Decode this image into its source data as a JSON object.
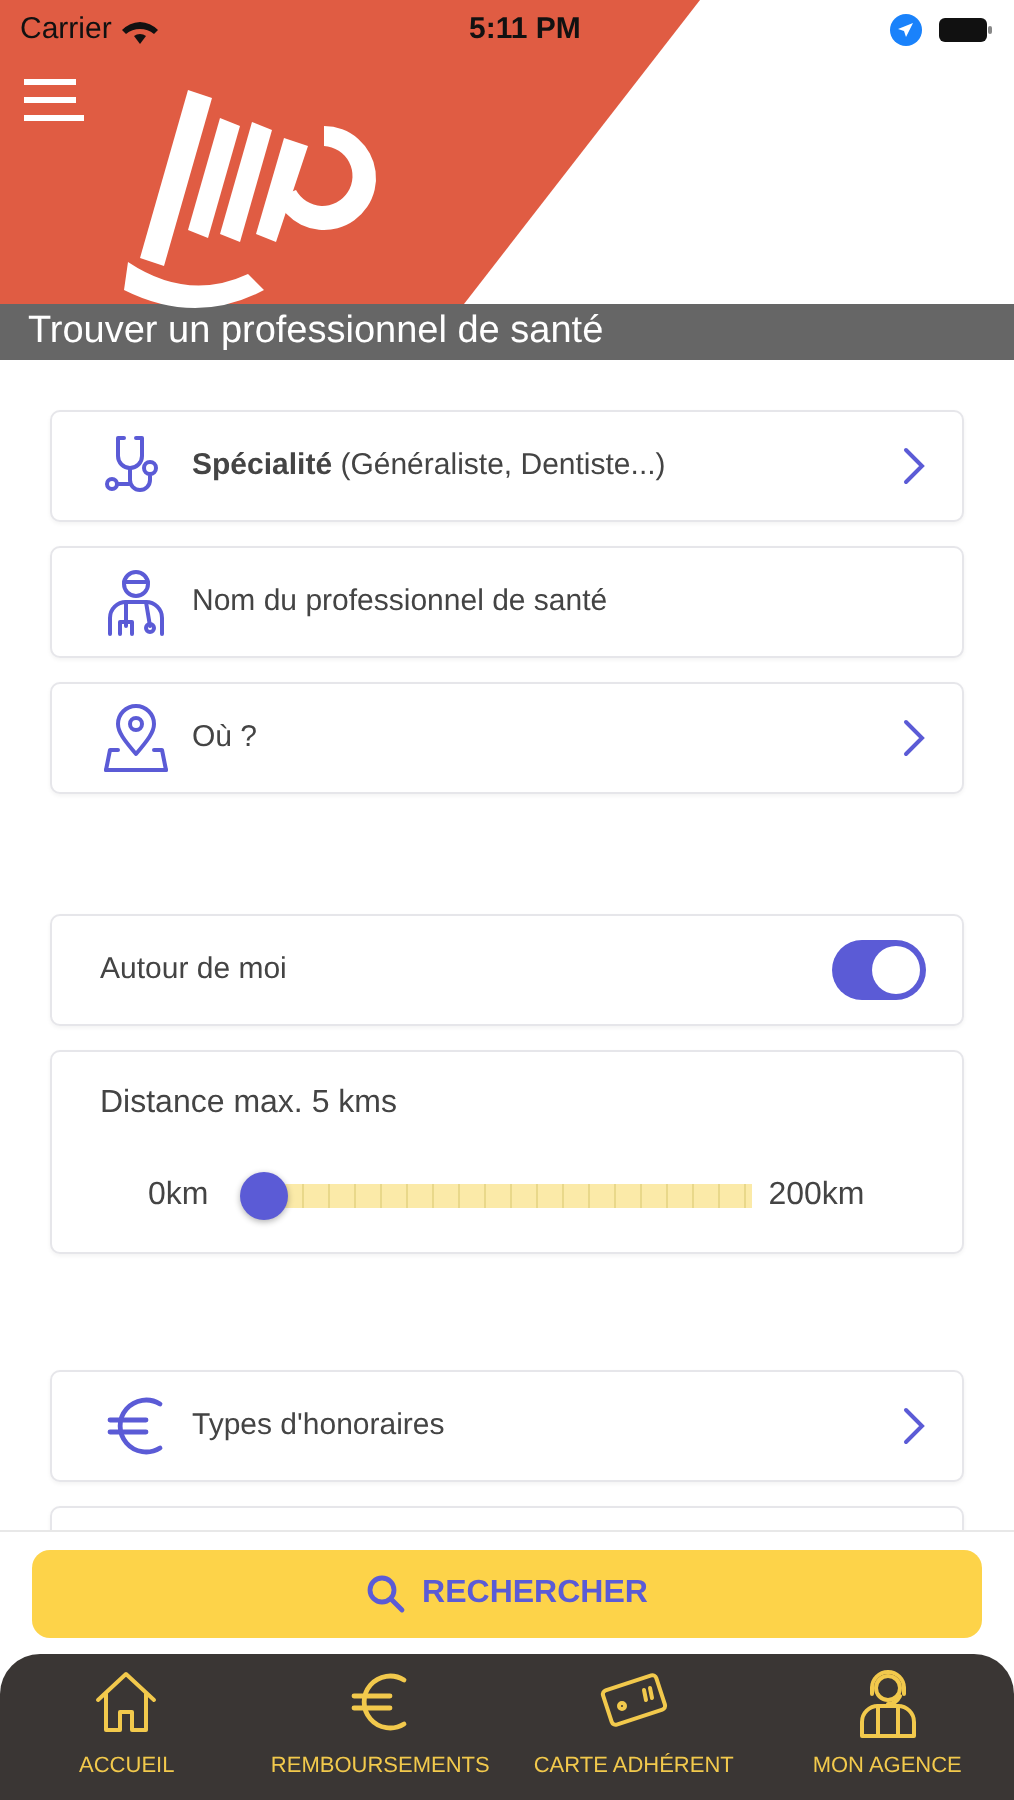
{
  "status_bar": {
    "carrier": "Carrier",
    "time": "5:11 PM"
  },
  "header": {
    "title": "Trouver un professionnel de santé"
  },
  "search_rows": [
    {
      "kind": "specialty",
      "label": "**Spécialité** (Généraliste, Dentiste...)",
      "chevron": true
    },
    {
      "kind": "doctor",
      "label": "Nom du professionnel de santé",
      "chevron": false
    },
    {
      "kind": "location",
      "label": "Où ?",
      "chevron": true
    }
  ],
  "around_me": {
    "label": "Autour de moi",
    "on": true
  },
  "distance": {
    "label": "Distance max. 5 kms",
    "min_label": "0km",
    "max_label": "200km",
    "level": 0.025
  },
  "fees": {
    "kind": "euro",
    "label": "Types d'honoraires",
    "chevron": true
  },
  "search_button": {
    "label": "RECHERCHER"
  },
  "tab_bar": [
    {
      "kind": "home",
      "label": "ACCUEIL"
    },
    {
      "kind": "euro",
      "label": "REMBOURSEMENTS"
    },
    {
      "kind": "card",
      "label": "CARTE ADHÉRENT"
    },
    {
      "kind": "agent",
      "label": "MON AGENCE"
    }
  ]
}
